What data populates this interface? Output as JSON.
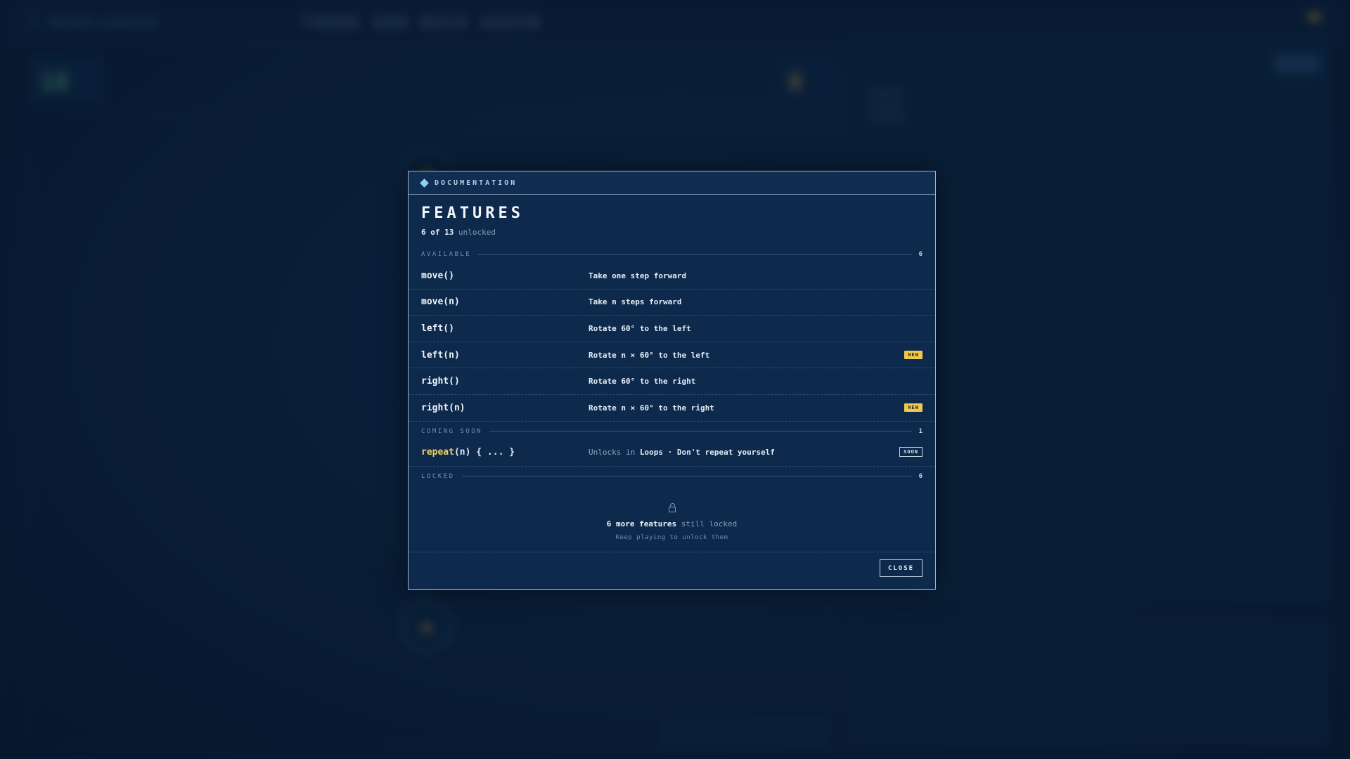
{
  "background": {
    "brand": "ROBOLANGUE",
    "level_title": "THERE AND BACK AGAIN",
    "moves_counter": "18",
    "stars_counter": "0"
  },
  "modal": {
    "header_label": "DOCUMENTATION",
    "title": "FEATURES",
    "unlocked_count": "6",
    "total_count": "13",
    "unlocked_of": "of",
    "unlocked_word": "unlocked",
    "sections": {
      "available": {
        "label": "AVAILABLE",
        "count": "6"
      },
      "coming_soon": {
        "label": "COMING SOON",
        "count": "1"
      },
      "locked": {
        "label": "LOCKED",
        "count": "6"
      }
    },
    "features": [
      {
        "fn": "move()",
        "desc": "Take one step forward",
        "badge": ""
      },
      {
        "fn": "move(n)",
        "desc": "Take n steps forward",
        "badge": ""
      },
      {
        "fn": "left()",
        "desc": "Rotate 60° to the left",
        "badge": ""
      },
      {
        "fn": "left(n)",
        "desc": "Rotate n × 60° to the left",
        "badge": "NEW"
      },
      {
        "fn": "right()",
        "desc": "Rotate 60° to the right",
        "badge": ""
      },
      {
        "fn": "right(n)",
        "desc": "Rotate n × 60° to the right",
        "badge": "NEW"
      }
    ],
    "coming_soon": {
      "fn_keyword": "repeat",
      "fn_rest": "(n) { ... }",
      "unlocks_prefix": "Unlocks in",
      "unlocks_level": "Loops · Don't repeat yourself",
      "badge": "SOON"
    },
    "locked": {
      "icon": "lock-icon",
      "count_text": "6 more features",
      "suffix": "still locked",
      "hint": "Keep playing to unlock them"
    },
    "close_label": "CLOSE"
  },
  "colors": {
    "modal_bg": "#0d2a4c",
    "accent_new": "#f2c84b",
    "keyword": "#f2cf6a",
    "diamond": "#8cd2f4"
  }
}
